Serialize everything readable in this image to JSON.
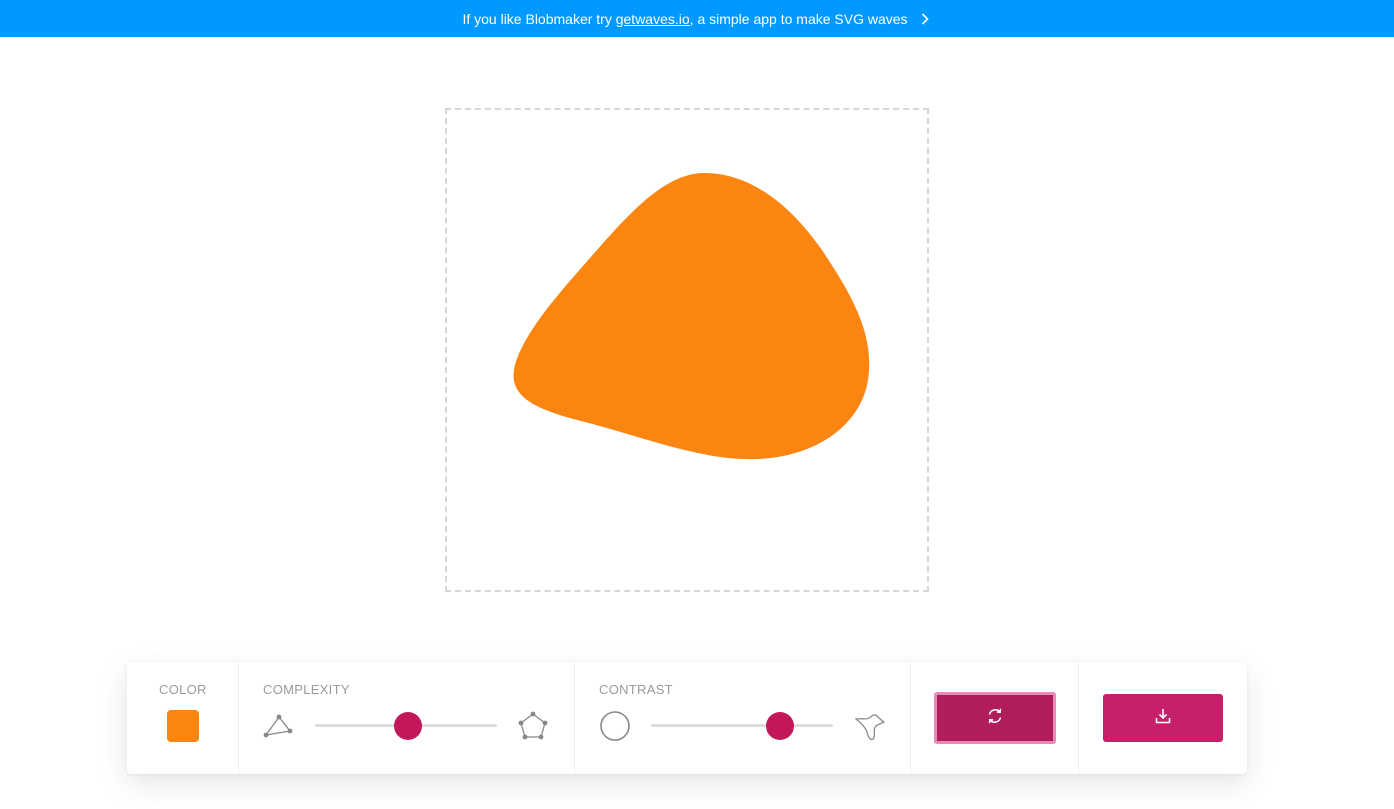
{
  "banner": {
    "text_before": "If you like Blobmaker try ",
    "link_text": "getwaves.io",
    "text_after": ", a simple app to make SVG waves",
    "chevron_icon": "chevron-right-icon",
    "background": "#0099ff"
  },
  "blob": {
    "fill_color": "#fb8511"
  },
  "controls": {
    "color": {
      "label": "COLOR",
      "value": "#fb8511"
    },
    "complexity": {
      "label": "COMPLEXITY",
      "min_icon": "triangle-nodes-icon",
      "max_icon": "pentagon-nodes-icon",
      "level": 0.51
    },
    "contrast": {
      "label": "CONTRAST",
      "min_icon": "circle-icon",
      "max_icon": "spiky-blob-icon",
      "level": 0.71
    },
    "randomize": {
      "icon": "refresh-icon",
      "color": "#b11d5c"
    },
    "download": {
      "icon": "download-icon",
      "color": "#c7206a"
    },
    "accent_color": "#c2185b"
  }
}
